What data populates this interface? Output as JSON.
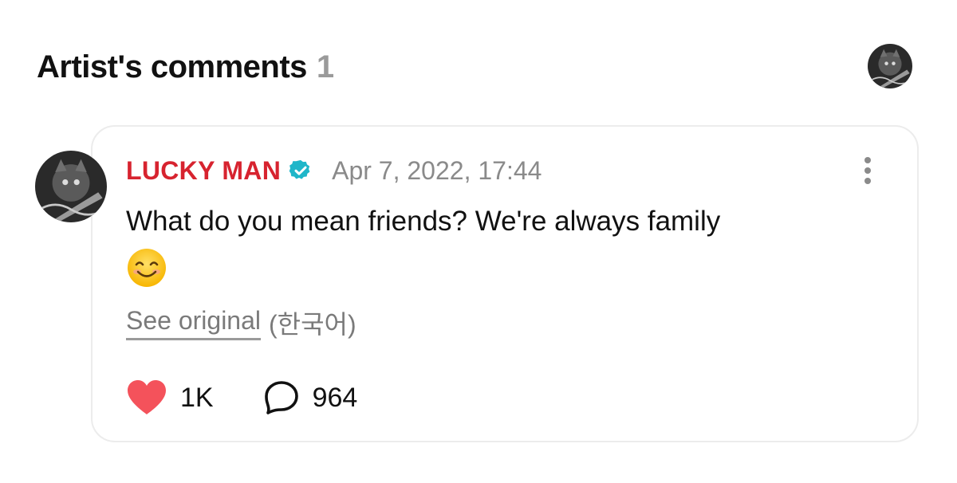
{
  "section": {
    "title": "Artist's comments",
    "count": "1"
  },
  "icons": {
    "header_avatar": "artist-avatar",
    "comment_avatar": "artist-avatar",
    "verified": "verified-badge-icon",
    "more": "vertical-ellipsis-icon",
    "emoji": "smiling-face-emoji",
    "like": "heart-icon",
    "reply": "speech-bubble-icon"
  },
  "comment": {
    "author": "LUCKY MAN",
    "timestamp": "Apr 7, 2022, 17:44",
    "text": "What do you mean friends? We're always family",
    "emoji": "😊",
    "see_original": "See original",
    "original_language": "(한국어)",
    "likes": "1K",
    "replies": "964"
  },
  "colors": {
    "author": "#d7232f",
    "verified": "#1fb6c9",
    "heart": "#f4525b",
    "muted": "#8a8a8a",
    "card_border": "#ececec"
  }
}
